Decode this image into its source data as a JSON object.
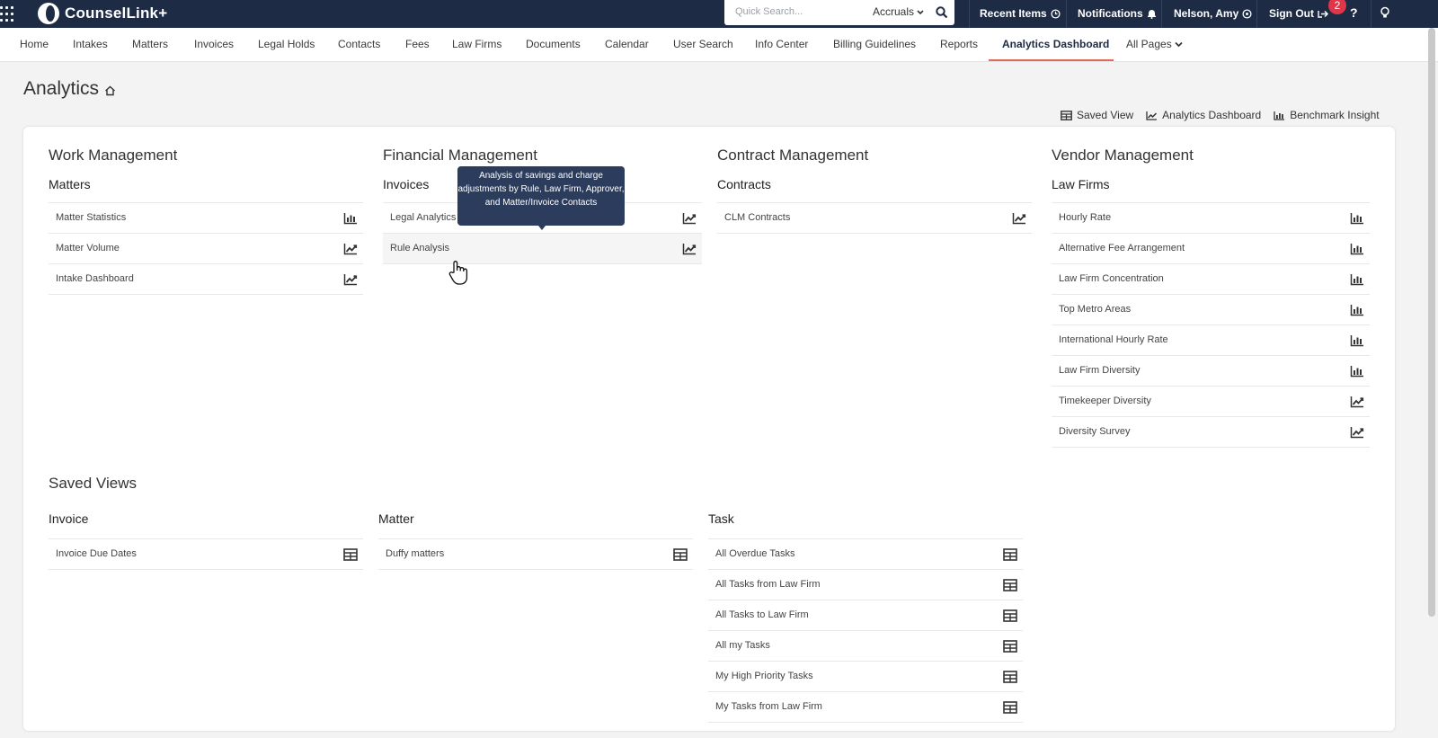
{
  "topbar": {
    "app_name": "CounselLink+",
    "search_placeholder": "Quick Search...",
    "search_scope": "Accruals",
    "recent_items": "Recent Items",
    "notifications": "Notifications",
    "user_name": "Nelson, Amy",
    "sign_out": "Sign Out",
    "badge_count": "2",
    "help": "?"
  },
  "nav": {
    "items": [
      "Home",
      "Intakes",
      "Matters",
      "Invoices",
      "Legal Holds",
      "Contacts",
      "Fees",
      "Law Firms",
      "Documents",
      "Calendar",
      "User Search",
      "Info Center",
      "Billing Guidelines",
      "Reports",
      "Analytics Dashboard",
      "All Pages"
    ],
    "active": "Analytics Dashboard"
  },
  "page": {
    "title": "Analytics",
    "view_links": [
      "Saved View",
      "Analytics Dashboard",
      "Benchmark Insight"
    ]
  },
  "sections": {
    "work": {
      "title": "Work Management",
      "subtitle": "Matters",
      "items": [
        {
          "label": "Matter Statistics",
          "icon": "bar-chart-icon"
        },
        {
          "label": "Matter Volume",
          "icon": "trend-chart-icon"
        },
        {
          "label": "Intake Dashboard",
          "icon": "trend-chart-icon"
        }
      ]
    },
    "financial": {
      "title": "Financial Management",
      "subtitle": "Invoices",
      "items": [
        {
          "label": "Legal Analytics",
          "icon": "trend-chart-icon"
        },
        {
          "label": "Rule Analysis",
          "icon": "trend-chart-icon"
        }
      ]
    },
    "contract": {
      "title": "Contract Management",
      "subtitle": "Contracts",
      "items": [
        {
          "label": "CLM Contracts",
          "icon": "trend-chart-icon"
        }
      ]
    },
    "vendor": {
      "title": "Vendor Management",
      "subtitle": "Law Firms",
      "items": [
        {
          "label": "Hourly Rate",
          "icon": "bar-chart-icon"
        },
        {
          "label": "Alternative Fee Arrangement",
          "icon": "bar-chart-icon"
        },
        {
          "label": "Law Firm Concentration",
          "icon": "bar-chart-icon"
        },
        {
          "label": "Top Metro Areas",
          "icon": "bar-chart-icon"
        },
        {
          "label": "International Hourly Rate",
          "icon": "bar-chart-icon"
        },
        {
          "label": "Law Firm Diversity",
          "icon": "bar-chart-icon"
        },
        {
          "label": "Timekeeper Diversity",
          "icon": "trend-chart-icon"
        },
        {
          "label": "Diversity Survey",
          "icon": "trend-chart-icon"
        }
      ]
    }
  },
  "saved_views": {
    "title": "Saved Views",
    "invoice": {
      "subtitle": "Invoice",
      "items": [
        {
          "label": "Invoice Due Dates",
          "icon": "table-icon"
        }
      ]
    },
    "matter": {
      "subtitle": "Matter",
      "items": [
        {
          "label": "Duffy matters",
          "icon": "table-icon"
        }
      ]
    },
    "task": {
      "subtitle": "Task",
      "items": [
        {
          "label": "All Overdue Tasks",
          "icon": "table-icon"
        },
        {
          "label": "All Tasks from Law Firm",
          "icon": "table-icon"
        },
        {
          "label": "All Tasks to Law Firm",
          "icon": "table-icon"
        },
        {
          "label": "All my Tasks",
          "icon": "table-icon"
        },
        {
          "label": "My High Priority Tasks",
          "icon": "table-icon"
        },
        {
          "label": "My Tasks from Law Firm",
          "icon": "table-icon"
        }
      ]
    }
  },
  "tooltip": {
    "text": "Analysis of savings and charge adjustments by Rule, Law Firm, Approver, and Matter/Invoice Contacts"
  }
}
